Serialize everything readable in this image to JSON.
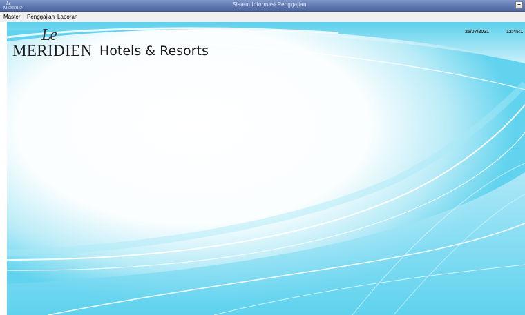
{
  "window": {
    "icon_text_top": "Le",
    "icon_text_bottom": "MERIDIEN",
    "title": "Sistem Informasi Penggajian",
    "minimize_label": "–"
  },
  "menu": [
    {
      "label": "Master"
    },
    {
      "label": "Penggajian"
    },
    {
      "label": "Laporan"
    }
  ],
  "logo": {
    "script": "Le",
    "brand": "MERIDIEN",
    "tagline": "Hotels & Resorts"
  },
  "status": {
    "date": "25/07/2021",
    "time": "12:45:1"
  },
  "colors": {
    "titlebar": "#5f78b0",
    "background_cyan": "#62d3ee"
  }
}
